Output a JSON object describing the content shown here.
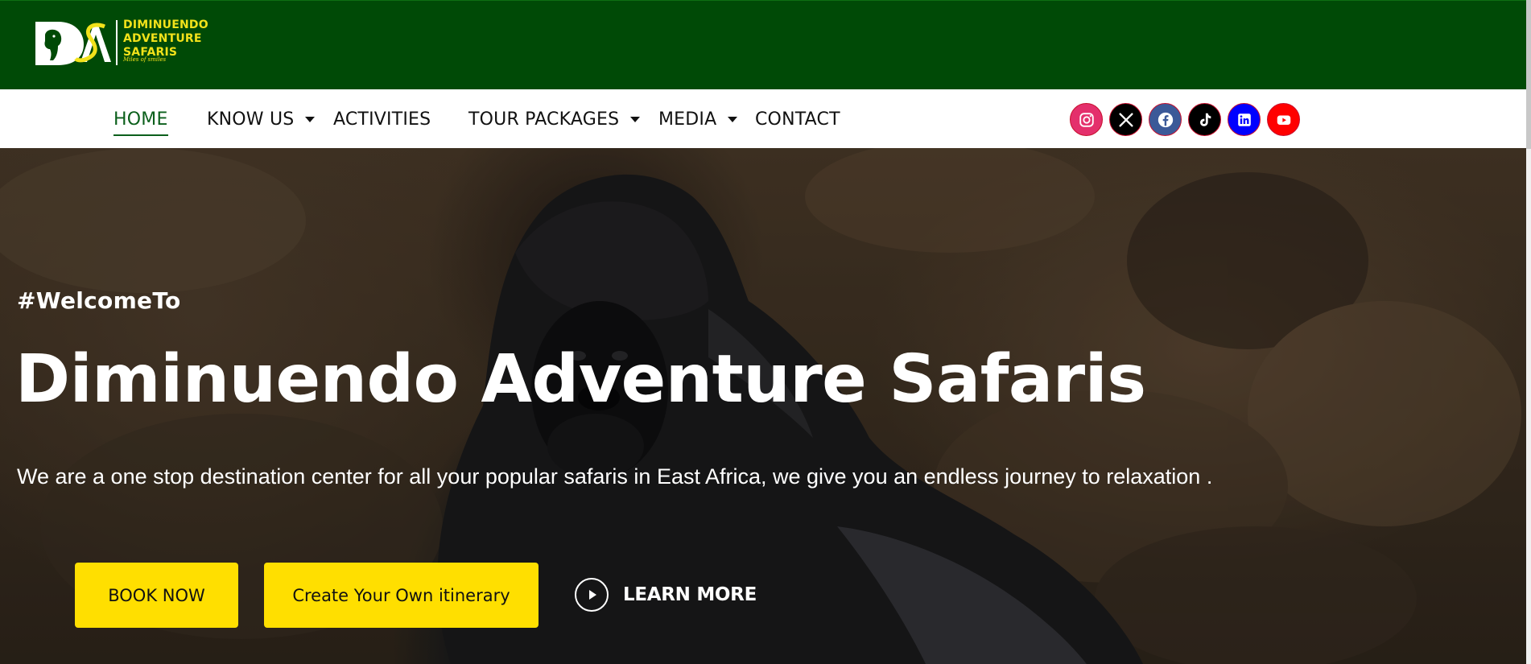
{
  "brand": {
    "mark": "DA",
    "name_lines": [
      "DIMINUENDO",
      "ADVENTURE",
      "SAFARIS"
    ],
    "tagline": "Miles of smiles",
    "colors": {
      "top_bar": "#004a06",
      "logo_text": "#f2e21a",
      "accent_yellow": "#ffdf00",
      "active_nav": "#0b5f1b"
    }
  },
  "nav": {
    "items": [
      {
        "label": "HOME",
        "active": true,
        "has_dropdown": false
      },
      {
        "label": "KNOW US",
        "active": false,
        "has_dropdown": true
      },
      {
        "label": "ACTIVITIES",
        "active": false,
        "has_dropdown": false
      },
      {
        "label": "TOUR PACKAGES",
        "active": false,
        "has_dropdown": true
      },
      {
        "label": "MEDIA",
        "active": false,
        "has_dropdown": true
      },
      {
        "label": "CONTACT",
        "active": false,
        "has_dropdown": false
      }
    ]
  },
  "socials": [
    {
      "icon": "instagram-icon",
      "color": "#e4306c"
    },
    {
      "icon": "x-icon",
      "color": "#000000"
    },
    {
      "icon": "facebook-icon",
      "color": "#3b5998"
    },
    {
      "icon": "tiktok-icon",
      "color": "#000000"
    },
    {
      "icon": "linkedin-icon",
      "color": "#0000ff"
    },
    {
      "icon": "youtube-icon",
      "color": "#ff0000"
    }
  ],
  "hero": {
    "tag": "#WelcomeTo",
    "title": "Diminuendo Adventure Safaris",
    "description": "We are a one stop destination center for all your popular safaris in East Africa, we give you an endless journey to relaxation .",
    "book_label": "BOOK NOW",
    "itinerary_label": "Create Your Own itinerary",
    "learn_label": "LEARN MORE"
  }
}
